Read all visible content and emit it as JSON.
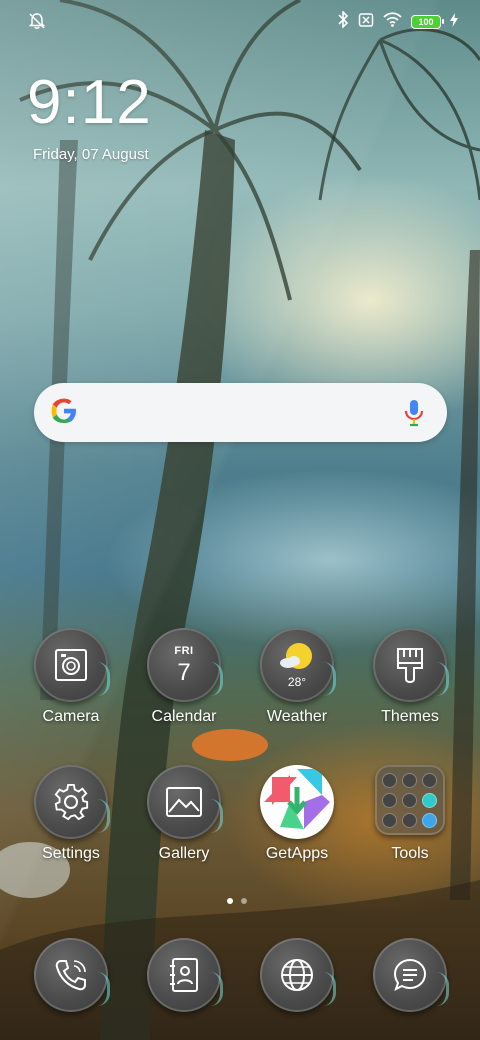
{
  "status_bar": {
    "alarm_icon": "alarm-off-icon",
    "bluetooth_icon": "bluetooth-icon",
    "sim_icon": "no-sim-icon",
    "wifi_icon": "wifi-icon",
    "battery_level": "100",
    "charging_icon": "bolt-icon"
  },
  "lockclock": {
    "time": "9:12",
    "date": "Friday, 07 August"
  },
  "search": {
    "logo": "google-g-icon",
    "mic": "mic-icon"
  },
  "apps_row1": [
    {
      "label": "Camera",
      "icon": "camera-icon"
    },
    {
      "label": "Calendar",
      "icon": "calendar-icon",
      "day": "FRI",
      "num": "7"
    },
    {
      "label": "Weather",
      "icon": "weather-icon",
      "temp": "28°"
    },
    {
      "label": "Themes",
      "icon": "brush-icon"
    }
  ],
  "apps_row2": [
    {
      "label": "Settings",
      "icon": "gear-icon"
    },
    {
      "label": "Gallery",
      "icon": "image-icon"
    },
    {
      "label": "GetApps",
      "icon": "getapps-icon"
    },
    {
      "label": "Tools",
      "icon": "folder-icon"
    }
  ],
  "dock": [
    {
      "icon": "phone-icon"
    },
    {
      "icon": "contacts-icon"
    },
    {
      "icon": "globe-icon"
    },
    {
      "icon": "messages-icon"
    }
  ],
  "pages": {
    "current": 1,
    "total": 2
  },
  "colors": {
    "battery": "#4cd037",
    "search_bg": "#f4f5f6",
    "icon_bg": "#4b4b4b"
  }
}
